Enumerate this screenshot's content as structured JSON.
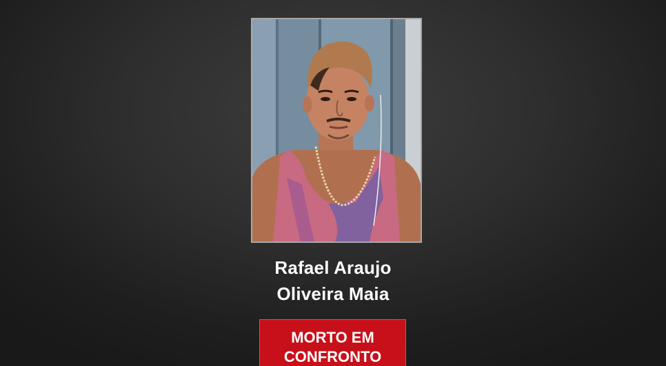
{
  "person": {
    "name_line1": "Rafael Araujo",
    "name_line2": "Oliveira Maia",
    "photo_description_icon": "portrait-photo"
  },
  "status": {
    "line1": "MORTO EM",
    "line2": "CONFRONTO",
    "color": "#c8101a"
  },
  "colors": {
    "background": "#2e2e2e",
    "frame_border": "#a9a9a9",
    "text": "#ffffff"
  }
}
